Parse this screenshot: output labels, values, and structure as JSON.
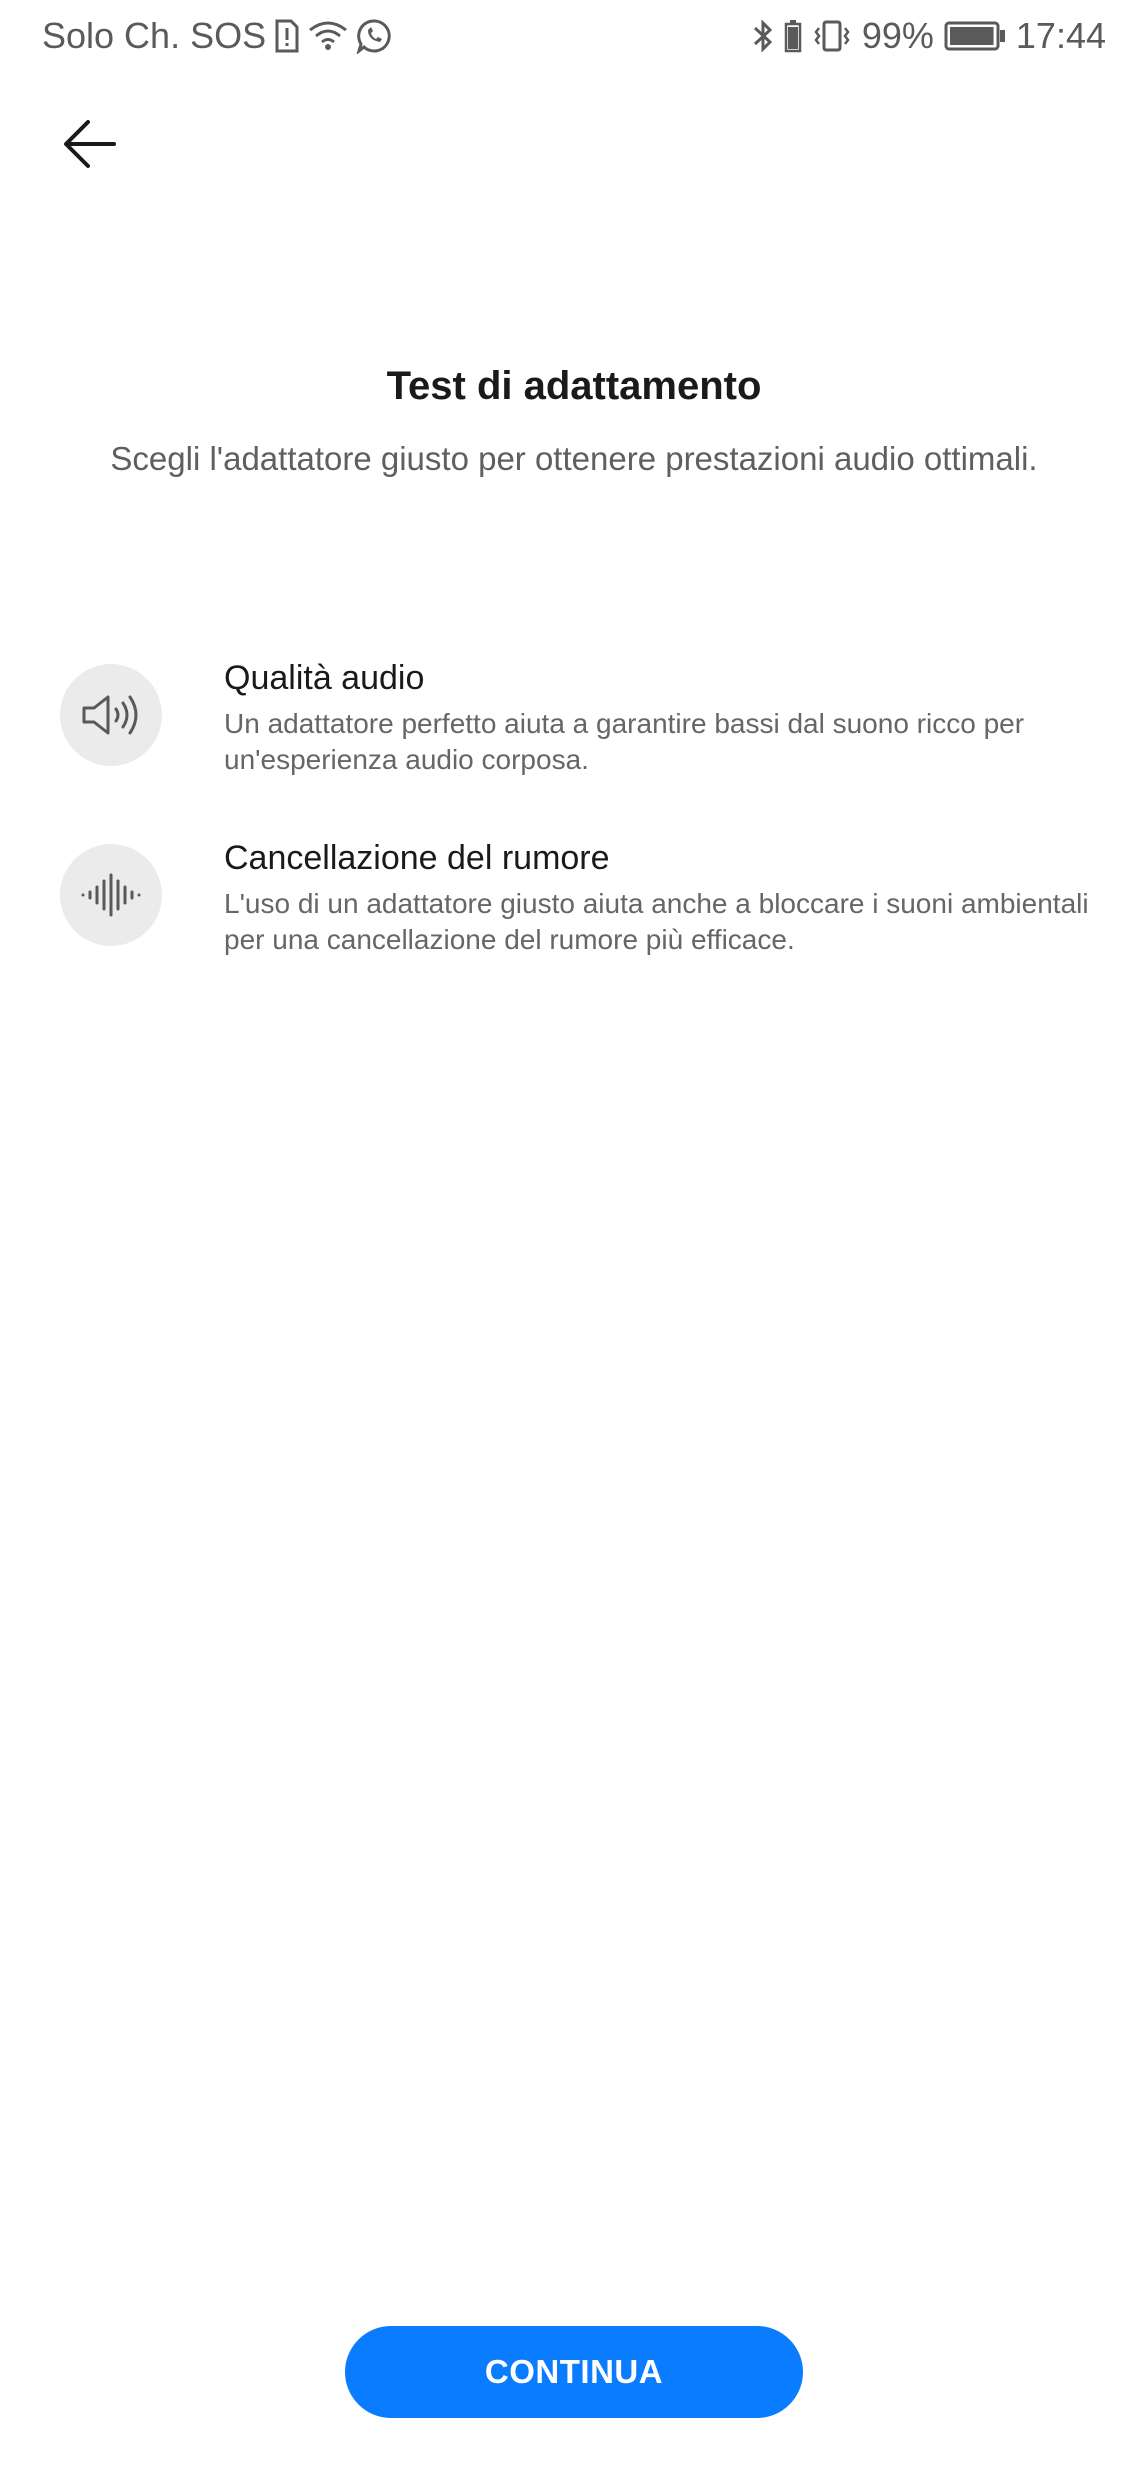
{
  "status_bar": {
    "carrier": "Solo Ch. SOS",
    "battery_percent": "99%",
    "time": "17:44",
    "battery_level": 0.99,
    "icons_left": [
      "sim-alert-icon",
      "wifi-icon",
      "whatsapp-icon"
    ],
    "icons_right": [
      "bluetooth-icon",
      "battery-small-icon",
      "vibrate-icon",
      "battery-icon"
    ]
  },
  "header": {
    "back_icon": "arrow-left-icon",
    "title": "Test di adattamento",
    "subtitle": "Scegli l'adattatore giusto per ottenere prestazioni audio ottimali."
  },
  "features": [
    {
      "icon": "speaker-icon",
      "title": "Qualità audio",
      "description": "Un adattatore perfetto aiuta a garantire bassi dal suono ricco per un'esperienza audio corposa."
    },
    {
      "icon": "sound-wave-icon",
      "title": "Cancellazione del rumore",
      "description": "L'uso di un adattatore giusto aiuta anche a bloccare i suoni ambientali per una cancellazione del rumore più efficace."
    }
  ],
  "footer": {
    "continue_label": "CONTINUA"
  },
  "colors": {
    "accent": "#0a7cff",
    "icon_bg": "#ebebeb",
    "text_primary": "#1a1a1a",
    "text_secondary": "#666666"
  }
}
